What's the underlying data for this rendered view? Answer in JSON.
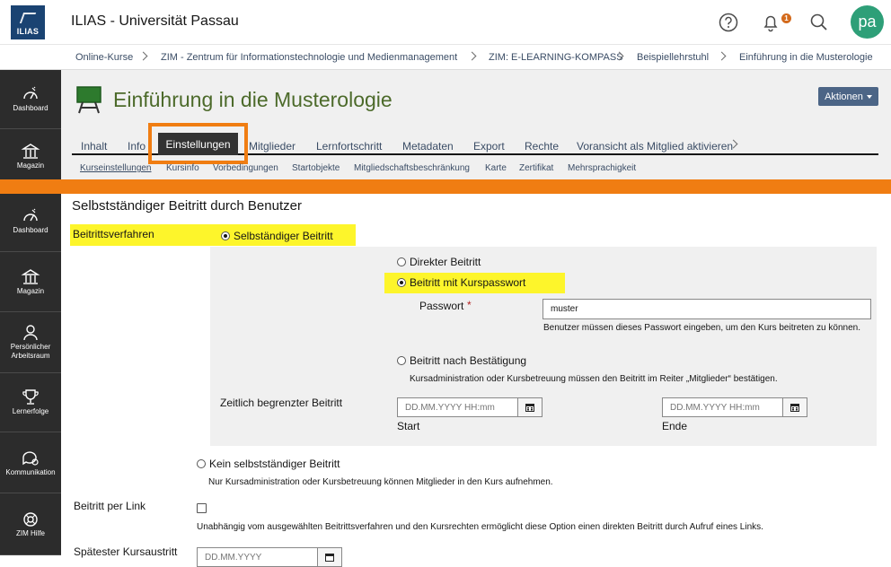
{
  "header": {
    "logo_text": "ILIAS",
    "app_title": "ILIAS - Universität Passau",
    "help_icon": "help-icon",
    "notification_icon": "bell-icon",
    "notification_count": "1",
    "search_icon": "search-icon",
    "avatar_initials": "pa"
  },
  "breadcrumb": [
    "Online-Kurse",
    "ZIM - Zentrum für Informationstechnologie und Medienmanagement",
    "ZIM: E-LEARNING-KOMPASS",
    "Beispiellehrstuhl",
    "Einführung in die Musterologie"
  ],
  "sidebar_top": [
    {
      "label": "Dashboard",
      "icon": "dashboard-icon"
    },
    {
      "label": "Magazin",
      "icon": "building-icon"
    }
  ],
  "sidebar_bottom": [
    {
      "label": "Dashboard",
      "icon": "dashboard-icon"
    },
    {
      "label": "Magazin",
      "icon": "building-icon"
    },
    {
      "label": "Persönlicher Arbeitsraum",
      "icon": "person-icon"
    },
    {
      "label": "Lernerfolge",
      "icon": "trophy-icon"
    },
    {
      "label": "Kommunikation",
      "icon": "chat-icon"
    },
    {
      "label": "ZIM Hilfe",
      "icon": "lifebuoy-icon"
    }
  ],
  "page": {
    "title": "Einführung in die Musterologie",
    "actions_label": "Aktionen",
    "tabs": [
      "Inhalt",
      "Info",
      "Einstellungen",
      "Mitglieder",
      "Lernfortschritt",
      "Metadaten",
      "Export",
      "Rechte",
      "Voransicht als Mitglied aktivieren"
    ],
    "active_tab": "Einstellungen",
    "subtabs": [
      "Kurseinstellungen",
      "Kursinfo",
      "Vorbedingungen",
      "Startobjekte",
      "Mitgliedschaftsbeschränkung",
      "Karte",
      "Zertifikat",
      "Mehrsprachigkeit"
    ]
  },
  "colors": {
    "accent": "#f07d12",
    "highlight": "#fdf52b",
    "title_green": "#4c6a2a",
    "sidebar": "#2c2c2c",
    "avatar": "#2e9f78"
  },
  "form": {
    "section_title": "Selbstständiger Beitritt durch Benutzer",
    "beitrittsverfahren_label": "Beitrittsverfahren",
    "option_self": "Selbständiger Beitritt",
    "option_direct": "Direkter Beitritt",
    "option_password": "Beitritt mit Kurspasswort",
    "password_label": "Passwort",
    "password_required": "*",
    "password_value": "muster",
    "password_help": "Benutzer müssen dieses Passwort eingeben, um den Kurs beitreten zu können.",
    "option_confirm": "Beitritt nach Bestätigung",
    "confirm_help": "Kursadministration oder Kursbetreuung müssen den Beitritt im Reiter „Mitglieder“ bestätigen.",
    "time_limited_label": "Zeitlich begrenzter Beitritt",
    "date_placeholder": "DD.MM.YYYY HH:mm",
    "start_label": "Start",
    "end_label": "Ende",
    "option_none": "Kein selbstständiger Beitritt",
    "none_help": "Nur Kursadministration oder Kursbetreuung können Mitglieder in den Kurs aufnehmen.",
    "link_label": "Beitritt per Link",
    "link_help": "Unabhängig vom ausgewählten Beitrittsverfahren und den Kursrechten ermöglicht diese Option einen direkten Beitritt durch Aufruf eines Links.",
    "latest_exit_label": "Spätester Kursaustritt",
    "latest_exit_placeholder": "DD.MM.YYYY"
  }
}
